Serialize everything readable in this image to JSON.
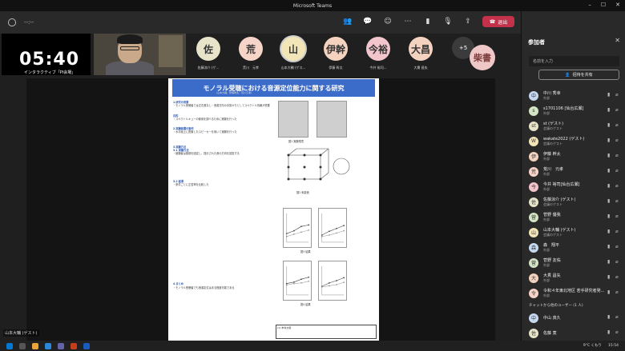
{
  "window": {
    "title": "Microsoft Teams"
  },
  "toolbar": {
    "meeting_info": "--:--",
    "leave_label": "退出"
  },
  "self_video": {
    "clock": "05:40",
    "caption": "インタラクティブ「PI会場」"
  },
  "avatars": [
    {
      "initial": "佐",
      "name": "佐藤涼介 (ゲ...",
      "color": "#e7e4c9"
    },
    {
      "initial": "荒",
      "name": "荒川　元孝",
      "color": "#f6d5c8"
    },
    {
      "initial": "山",
      "name": "山本大輔 (ゲス...",
      "color": "#f2e5b8"
    },
    {
      "initial": "伊幹",
      "name": "伊藤 幹太",
      "color": "#f3d3c0"
    },
    {
      "initial": "今裕",
      "name": "今井 裕司...",
      "color": "#f2c4cb"
    },
    {
      "initial": "大昌",
      "name": "大貫 昌矢",
      "color": "#f3d3c0"
    }
  ],
  "more_count": "+5",
  "big_avatar": {
    "initial": "柴書"
  },
  "poster": {
    "title": "モノラル受聴における音源定位能力に関する研究",
    "subtitle": "(山本大輔、伊藤幹太、荒川元孝)",
    "sec1": "1.研究の背景",
    "sec1_text": "・モノラル受聴者では左右差なし・音源方向の手掛かりとしてスペクトル情報が重要",
    "sec2": "目的",
    "sec2_text": "・スペクトルキューの使用を調べるために実験を行った",
    "sec3": "2.実験装置の製作",
    "sec3_text": "・水平面上に配置したスピーカーを用いて実験を行った",
    "sec4": "3.実験方法",
    "sec4_sub1": "3.1 実験方法",
    "sec4_text": "・被験者は頭部を固定し、提示された音の方向を回答する",
    "sec4_sub2": "3.2 結果",
    "sec4_text2": "・条件ごとに正答率を比較した",
    "sec5": "4.まとめ",
    "sec5_text": "・モノラル受聴者でも音源定位はある程度可能である",
    "fig1_caption": "図1 実験環境",
    "fig2_caption": "図2 刺激音",
    "fig3_caption": "図3 結果",
    "fig4_caption": "図4 結果",
    "reference": "[1] 参考文献"
  },
  "stage_label": "山本大輔 (ゲスト)",
  "panel": {
    "header": "参加者",
    "search_placeholder": "名前を入力",
    "invite_label": "招待を共有",
    "section_label": "チャットから他のユーザー (1 人)",
    "participants": [
      {
        "initial": "中",
        "name": "中川 秀幸",
        "desc": "外部",
        "color": "#c6d9f1"
      },
      {
        "initial": "s",
        "name": "s1701106 [仙台広瀬]",
        "desc": "外部",
        "color": "#d4e5c6"
      },
      {
        "initial": "st",
        "name": "st (ゲスト)",
        "desc": "会議のゲスト",
        "color": "#e7e4c9"
      },
      {
        "initial": "W",
        "name": "wakate2022 (ゲスト)",
        "desc": "会議のゲスト",
        "color": "#f2e5b8"
      },
      {
        "initial": "伊",
        "name": "伊藤 幹太",
        "desc": "外部",
        "color": "#f3d3c0"
      },
      {
        "initial": "荒",
        "name": "荒川　元孝",
        "desc": "外部",
        "color": "#f6d5c8"
      },
      {
        "initial": "今",
        "name": "今井 裕司[仙台広瀬]",
        "desc": "外部",
        "color": "#f2c4cb"
      },
      {
        "initial": "佐",
        "name": "佐藤涼介 (ゲスト)",
        "desc": "会議のゲスト",
        "color": "#e7e4c9"
      },
      {
        "initial": "菅",
        "name": "菅野 優我",
        "desc": "外部",
        "color": "#d4e5c6"
      },
      {
        "initial": "山",
        "name": "山本大輔 (ゲスト)",
        "desc": "会議のゲスト",
        "color": "#f2e5b8"
      },
      {
        "initial": "森",
        "name": "森　翔平",
        "desc": "外部",
        "color": "#c6d9f1"
      },
      {
        "initial": "菅",
        "name": "菅野 友佑",
        "desc": "外部",
        "color": "#d4e5c6"
      },
      {
        "initial": "大",
        "name": "大貫 昌矢",
        "desc": "外部",
        "color": "#f3d3c0"
      },
      {
        "initial": "令",
        "name": "令和４年東北地区 若手研究者発...",
        "desc": "外部",
        "color": "#f6d5c8"
      }
    ],
    "chat_users": [
      {
        "initial": "中",
        "name": "中山 真久",
        "desc": "",
        "color": "#c6d9f1"
      },
      {
        "initial": "佐",
        "name": "佐藤 寛",
        "desc": "",
        "color": "#e7e4c9"
      }
    ]
  },
  "taskbar": {
    "time": "15:54",
    "weather": "9°C くもり"
  },
  "chart_data": [
    {
      "type": "line",
      "series": [
        {
          "values": [
            30,
            40,
            55,
            60
          ]
        },
        {
          "values": [
            20,
            28,
            35,
            42
          ]
        }
      ],
      "ylim": [
        0,
        100
      ]
    },
    {
      "type": "line",
      "series": [
        {
          "values": [
            25,
            38,
            48,
            58
          ]
        },
        {
          "values": [
            20,
            25,
            32,
            40
          ]
        }
      ],
      "ylim": [
        0,
        100
      ]
    },
    {
      "type": "line",
      "series": [
        {
          "values": [
            40,
            45,
            55,
            62
          ]
        },
        {
          "values": [
            35,
            40,
            42,
            48
          ]
        }
      ],
      "ylim": [
        0,
        100
      ]
    },
    {
      "type": "line",
      "series": [
        {
          "values": [
            30,
            42,
            50,
            60
          ]
        },
        {
          "values": [
            28,
            32,
            36,
            44
          ]
        }
      ],
      "ylim": [
        0,
        100
      ]
    }
  ]
}
